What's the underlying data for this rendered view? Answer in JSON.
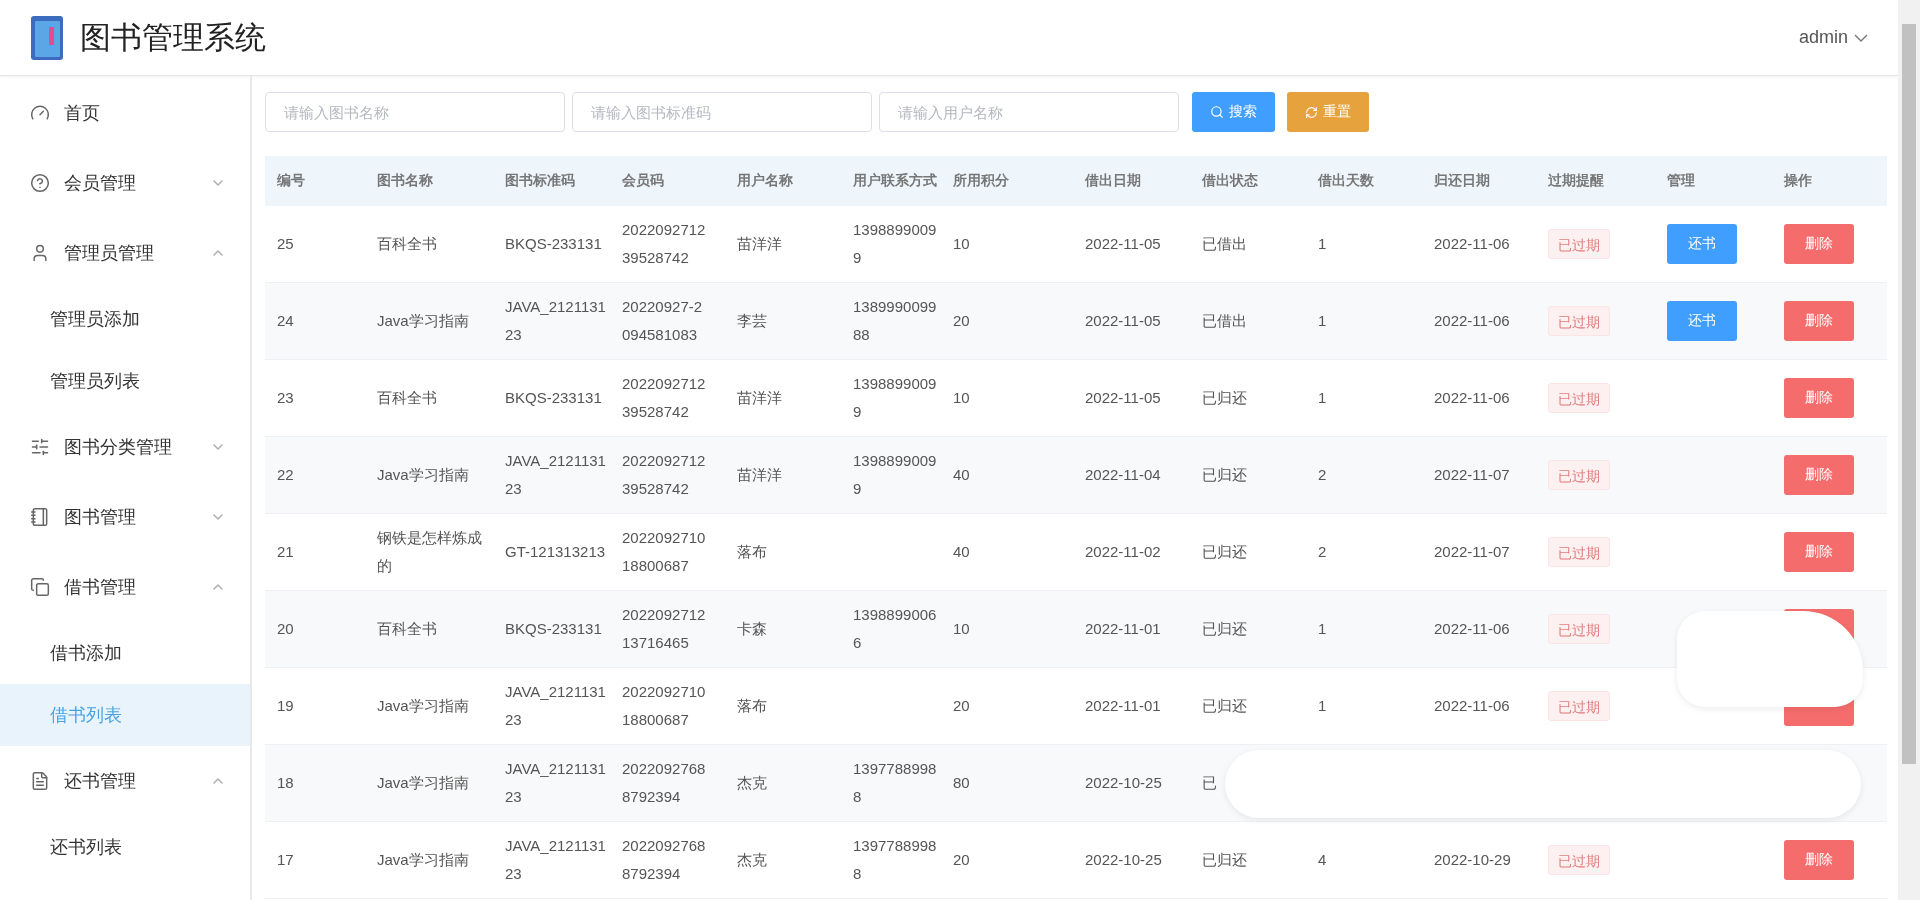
{
  "header": {
    "title": "图书管理系统",
    "user": "admin"
  },
  "sidebar": {
    "items": [
      {
        "label": "首页",
        "kind": "link"
      },
      {
        "label": "会员管理",
        "kind": "group",
        "expanded": false
      },
      {
        "label": "管理员管理",
        "kind": "group",
        "expanded": true,
        "children": [
          {
            "label": "管理员添加",
            "selected": false
          },
          {
            "label": "管理员列表",
            "selected": false
          }
        ]
      },
      {
        "label": "图书分类管理",
        "kind": "group",
        "expanded": false
      },
      {
        "label": "图书管理",
        "kind": "group",
        "expanded": false
      },
      {
        "label": "借书管理",
        "kind": "group",
        "expanded": true,
        "children": [
          {
            "label": "借书添加",
            "selected": false
          },
          {
            "label": "借书列表",
            "selected": true
          }
        ]
      },
      {
        "label": "还书管理",
        "kind": "group",
        "expanded": true,
        "children": [
          {
            "label": "还书列表",
            "selected": false
          }
        ]
      }
    ]
  },
  "search": {
    "fields": [
      {
        "placeholder": "请输入图书名称"
      },
      {
        "placeholder": "请输入图书标准码"
      },
      {
        "placeholder": "请输入用户名称"
      }
    ],
    "search_button": "搜索",
    "reset_button": "重置"
  },
  "table": {
    "columns": [
      "编号",
      "图书名称",
      "图书标准码",
      "会员码",
      "用户名称",
      "用户联系方式",
      "所用积分",
      "借出日期",
      "借出状态",
      "借出天数",
      "归还日期",
      "过期提醒",
      "管理",
      "操作"
    ],
    "rows": [
      {
        "id": "25",
        "book": "百科全书",
        "code": "BKQS-233131",
        "member": "2022092712 39528742",
        "user": "苗洋洋",
        "phone": "1398899009 9",
        "points": "10",
        "date": "2022-11-05",
        "status": "已借出",
        "days": "1",
        "return_date": "2022-11-06",
        "tag": "已过期",
        "manage": "还书",
        "action": "删除"
      },
      {
        "id": "24",
        "book": "Java学习指南",
        "code": "JAVA_212113123",
        "member": "20220927-2 094581083",
        "user": "李芸",
        "phone": "1389990099 88",
        "points": "20",
        "date": "2022-11-05",
        "status": "已借出",
        "days": "1",
        "return_date": "2022-11-06",
        "tag": "已过期",
        "manage": "还书",
        "action": "删除"
      },
      {
        "id": "23",
        "book": "百科全书",
        "code": "BKQS-233131",
        "member": "2022092712 39528742",
        "user": "苗洋洋",
        "phone": "1398899009 9",
        "points": "10",
        "date": "2022-11-05",
        "status": "已归还",
        "days": "1",
        "return_date": "2022-11-06",
        "tag": "已过期",
        "action": "删除"
      },
      {
        "id": "22",
        "book": "Java学习指南",
        "code": "JAVA_212113123",
        "member": "2022092712 39528742",
        "user": "苗洋洋",
        "phone": "1398899009 9",
        "points": "40",
        "date": "2022-11-04",
        "status": "已归还",
        "days": "2",
        "return_date": "2022-11-07",
        "tag": "已过期",
        "action": "删除"
      },
      {
        "id": "21",
        "book": "钢铁是怎样炼成的",
        "code": "GT-121313213",
        "member": "2022092710 18800687",
        "user": "落布",
        "points": "40",
        "date": "2022-11-02",
        "status": "已归还",
        "days": "2",
        "return_date": "2022-11-07",
        "tag": "已过期",
        "action": "删除"
      },
      {
        "id": "20",
        "book": "百科全书",
        "code": "BKQS-233131",
        "member": "2022092712 13716465",
        "user": "卡森",
        "phone": "1398899006 6",
        "points": "10",
        "date": "2022-11-01",
        "status": "已归还",
        "days": "1",
        "return_date": "2022-11-06",
        "tag": "已过期",
        "button_under_toast": true,
        "small_toast": true
      },
      {
        "id": "19",
        "book": "Java学习指南",
        "code": "JAVA_212113123",
        "member": "2022092710 18800687",
        "user": "落布",
        "points": "20",
        "date": "2022-11-01",
        "status": "已归还",
        "days": "1",
        "return_date": "2022-11-06",
        "tag": "已过期",
        "button_under_toast": true
      },
      {
        "id": "18",
        "book": "Java学习指南",
        "code": "JAVA_212113123",
        "member": "2022092768 8792394",
        "user": "杰克",
        "phone": "1397788998 8",
        "points": "80",
        "date": "2022-10-25",
        "status": "已",
        "wide_toast": true
      },
      {
        "id": "17",
        "book": "Java学习指南",
        "code": "JAVA_212113123",
        "member": "2022092768 8792394",
        "user": "杰克",
        "phone": "1397788998 8",
        "points": "20",
        "date": "2022-10-25",
        "status": "已归还",
        "days": "4",
        "return_date": "2022-10-29",
        "tag": "已过期",
        "action": "删除"
      }
    ]
  }
}
